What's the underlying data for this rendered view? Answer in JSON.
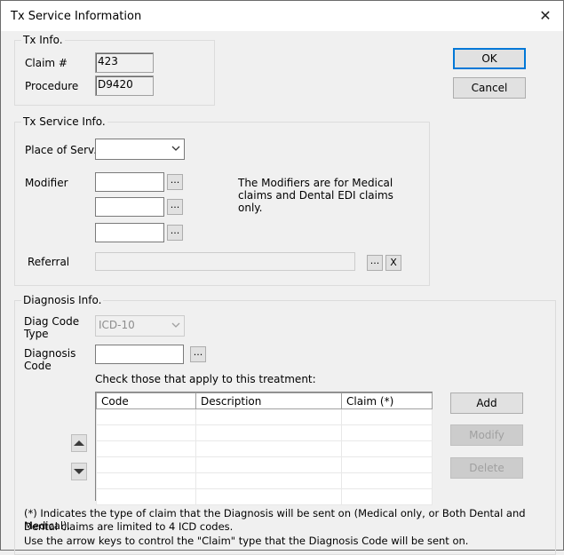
{
  "window": {
    "title": "Tx Service Information",
    "close_label": "✕"
  },
  "tx_info": {
    "group_label": "Tx Info.",
    "claim_label": "Claim #",
    "claim_value": "423",
    "procedure_label": "Procedure",
    "procedure_value": "D9420"
  },
  "buttons": {
    "ok": "OK",
    "cancel": "Cancel",
    "add": "Add",
    "modify": "Modify",
    "delete": "Delete",
    "ellipsis": "...",
    "clear": "X"
  },
  "tx_service_info": {
    "group_label": "Tx Service Info.",
    "place_label": "Place of Serv.",
    "place_value": "",
    "modifier_label": "Modifier",
    "modifier_note": "The Modifiers are for Medical claims and Dental EDI claims only.",
    "referral_label": "Referral",
    "referral_value": ""
  },
  "diagnosis_info": {
    "group_label": "Diagnosis Info.",
    "diag_type_label": "Diag Code Type",
    "diag_type_value": "ICD-10",
    "diag_code_label": "Diagnosis Code",
    "diag_code_value": "",
    "check_label": "Check those that apply to this treatment:",
    "columns": [
      "Code",
      "Description",
      "Claim (*)"
    ],
    "rows": [],
    "footnote_1": "(*) Indicates the type of claim that the Diagnosis will be sent on (Medical only, or Both Dental and Medical).",
    "footnote_2": "Dental claims are limited to 4 ICD codes.",
    "footnote_3": "Use the arrow keys to control the \"Claim\" type that the Diagnosis Code will be sent on."
  }
}
